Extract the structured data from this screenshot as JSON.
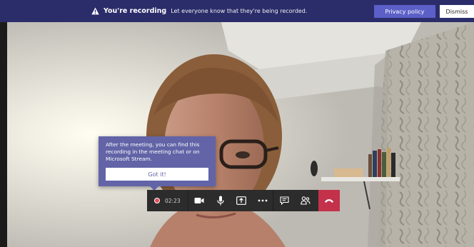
{
  "banner": {
    "title": "You're recording",
    "message": "Let everyone know that they're being recorded.",
    "privacy_button": "Privacy policy",
    "dismiss_button": "Dismiss",
    "icon": "warning-icon"
  },
  "tooltip": {
    "text": "After the meeting, you can find this recording in the meeting chat or on Microsoft Stream.",
    "button": "Got it!"
  },
  "controls": {
    "recording_time": "02:23",
    "icons": [
      "record-indicator-icon",
      "camera-icon",
      "microphone-icon",
      "share-screen-icon",
      "more-options-icon",
      "chat-icon",
      "participants-icon",
      "hang-up-icon"
    ]
  },
  "colors": {
    "banner_bg": "#2b2d6a",
    "accent": "#6264a7",
    "privacy_button": "#5b5fc7",
    "hang_up": "#c4314b",
    "recording_dot": "#e84a55",
    "bar_bg": "#2d2c2c"
  }
}
